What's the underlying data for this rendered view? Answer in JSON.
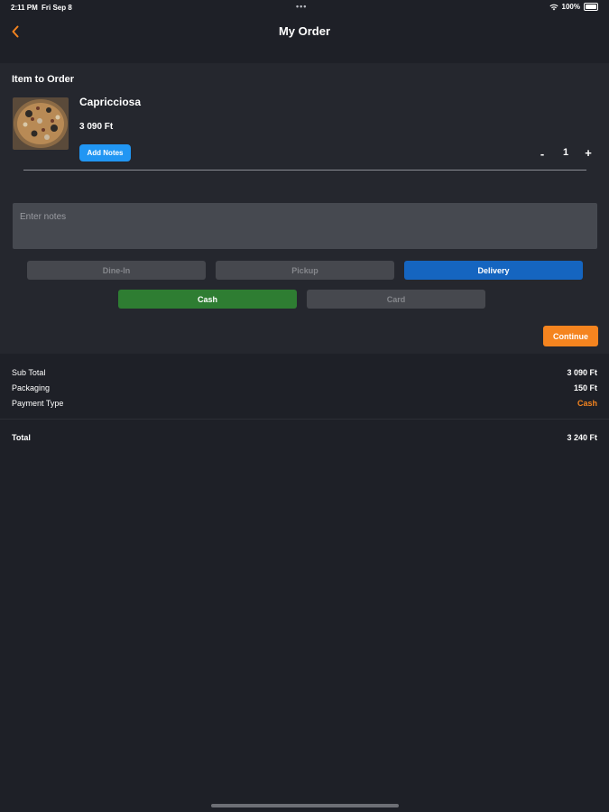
{
  "status_bar": {
    "time": "2:11 PM",
    "date": "Fri Sep 8",
    "dots": "•••",
    "battery": "100%"
  },
  "header": {
    "title": "My Order"
  },
  "order": {
    "heading": "Item to Order",
    "item": {
      "name": "Capricciosa",
      "price": "3 090 Ft",
      "add_notes_label": "Add Notes",
      "quantity": "1",
      "minus": "-",
      "plus": "+"
    },
    "notes_placeholder": "Enter notes",
    "order_types": [
      "Dine-In",
      "Pickup",
      "Delivery"
    ],
    "selected_order_type": "Delivery",
    "payment_methods": [
      "Cash",
      "Card"
    ],
    "selected_payment": "Cash",
    "continue_label": "Continue"
  },
  "summary": {
    "subtotal_label": "Sub Total",
    "subtotal_value": "3 090 Ft",
    "packaging_label": "Packaging",
    "packaging_value": "150 Ft",
    "payment_type_label": "Payment Type",
    "payment_type_value": "Cash",
    "total_label": "Total",
    "total_value": "3 240 Ft"
  },
  "colors": {
    "background": "#1e2027",
    "panel": "#25272e",
    "accent_orange": "#f5841f",
    "delivery_blue": "#1565c0",
    "cash_green": "#2e7d32",
    "add_notes_blue": "#2196f3"
  },
  "icons": {
    "back": "chevron-left-icon",
    "wifi": "wifi-icon",
    "battery": "battery-icon"
  }
}
